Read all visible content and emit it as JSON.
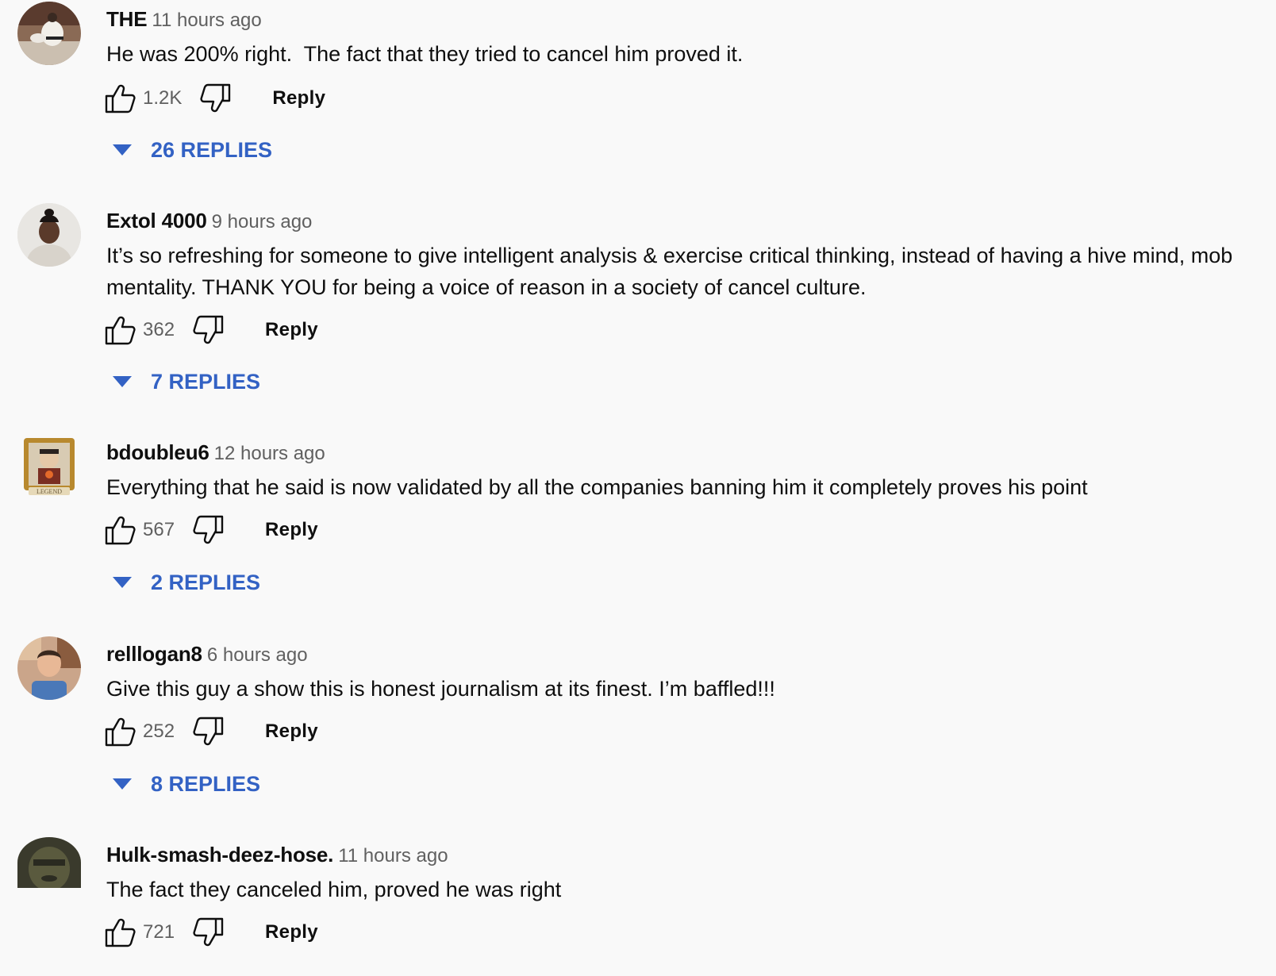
{
  "comments": [
    {
      "author": "THE",
      "timestamp": "11 hours ago",
      "text": "He was 200% right.  The fact that they tried to cancel him proved it.",
      "likes": "1.2K",
      "reply_label": "Reply",
      "replies_label": "26 REPLIES",
      "avatar_icon": "karate-photo-avatar"
    },
    {
      "author": "Extol 4000",
      "timestamp": "9 hours ago",
      "text": "It’s so refreshing for someone to give intelligent analysis & exercise critical thinking, instead of having a hive mind, mob\nmentality. THANK YOU for being a voice of reason in a society of cancel culture.",
      "likes": "362",
      "reply_label": "Reply",
      "replies_label": "7 REPLIES",
      "avatar_icon": "person-photo-avatar"
    },
    {
      "author": "bdoubleu6",
      "timestamp": "12 hours ago",
      "text": "Everything that he said is now validated by all the companies banning him it completely proves his point",
      "likes": "567",
      "reply_label": "Reply",
      "replies_label": "2 REPLIES",
      "avatar_icon": "legend-frame-avatar",
      "avatar_badge": "LEGEND"
    },
    {
      "author": "relllogan8",
      "timestamp": "6 hours ago",
      "text": "Give this guy a show this is honest journalism at its finest. I’m baffled!!!",
      "likes": "252",
      "reply_label": "Reply",
      "replies_label": "8 REPLIES",
      "avatar_icon": "child-photo-avatar"
    },
    {
      "author": "Hulk-smash-deez-hose.",
      "timestamp": "11 hours ago",
      "text": "The fact they canceled him, proved he was right",
      "likes": "721",
      "reply_label": "Reply",
      "avatar_icon": "dark-face-avatar"
    }
  ],
  "colors": {
    "background": "#f9f9f9",
    "replies_link": "#3362c4",
    "timestamp": "#606060"
  }
}
